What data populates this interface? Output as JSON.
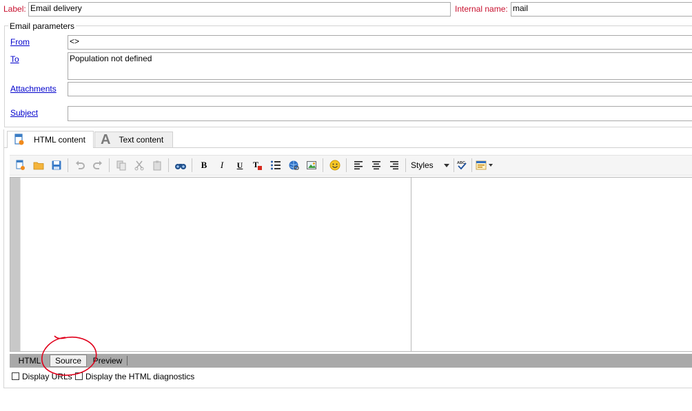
{
  "header": {
    "label_caption": "Label:",
    "label_value": "Email delivery",
    "internal_caption": "Internal name:",
    "internal_value": "mail"
  },
  "email_params": {
    "group_title": "Email parameters",
    "from_label": "From",
    "from_value": "<>",
    "to_label": "To",
    "to_value": "Population not defined",
    "attachments_label": "Attachments",
    "attachments_value": "",
    "subject_label": "Subject",
    "subject_value": ""
  },
  "content_tabs": [
    {
      "label": "HTML content",
      "icon": "html-document-icon",
      "active": true
    },
    {
      "label": "Text content",
      "icon": "text-a-icon",
      "active": false
    }
  ],
  "toolbar": {
    "styles_label": "Styles"
  },
  "view_tabs": [
    {
      "label": "HTML",
      "active": false
    },
    {
      "label": "Source",
      "active": true
    },
    {
      "label": "Preview",
      "active": false
    }
  ],
  "options": {
    "display_urls": "Display URLs",
    "display_diagnostics": "Display the HTML diagnostics"
  },
  "annotation_color": "#e0001b"
}
